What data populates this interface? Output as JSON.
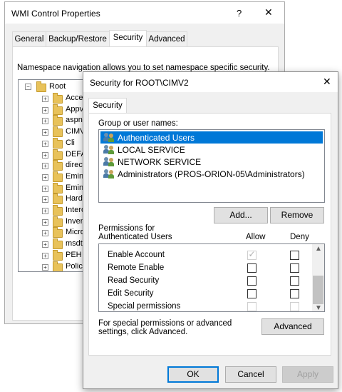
{
  "back_window": {
    "title": "WMI Control Properties",
    "help": "?",
    "close": "✕",
    "tabs": [
      "General",
      "Backup/Restore",
      "Security",
      "Advanced"
    ],
    "active_tab": "Security",
    "description": "Namespace navigation allows you to set namespace specific security.",
    "tree": {
      "root": "Root",
      "children": [
        "Acces",
        "Appv",
        "aspne",
        "CIMV2",
        "Cli",
        "DEFA",
        "directo",
        "Emine",
        "Emine",
        "Hardw",
        "Interop",
        "Invent",
        "Micros",
        "msdtc",
        "PEH",
        "Policy"
      ]
    }
  },
  "dialog": {
    "title": "Security for ROOT\\CIMV2",
    "close": "✕",
    "tab": "Security",
    "group_label": "Group or user names:",
    "users": [
      "Authenticated Users",
      "LOCAL SERVICE",
      "NETWORK SERVICE",
      "Administrators (PROS-ORION-05\\Administrators)"
    ],
    "selected_user": "Authenticated Users",
    "add_button": "Add...",
    "remove_button": "Remove",
    "permissions_label": "Permissions for Authenticated Users",
    "allow_header": "Allow",
    "deny_header": "Deny",
    "permissions": [
      {
        "name": "Enable Account",
        "allow": "checked-disabled",
        "deny": "unchecked"
      },
      {
        "name": "Remote Enable",
        "allow": "unchecked",
        "deny": "unchecked"
      },
      {
        "name": "Read Security",
        "allow": "unchecked",
        "deny": "unchecked"
      },
      {
        "name": "Edit Security",
        "allow": "unchecked",
        "deny": "unchecked"
      },
      {
        "name": "Special permissions",
        "allow": "disabled",
        "deny": "disabled"
      }
    ],
    "special_text": "For special permissions or advanced settings, click Advanced.",
    "advanced_button": "Advanced",
    "ok_button": "OK",
    "cancel_button": "Cancel",
    "apply_button": "Apply"
  },
  "icons": {
    "scroll_up": "up-arrow-icon",
    "scroll_down": "down-arrow-icon",
    "user_group": "user-group-icon",
    "folder": "folder-icon"
  },
  "colors": {
    "selection": "#0078d7",
    "primary_border": "#0078d7"
  }
}
